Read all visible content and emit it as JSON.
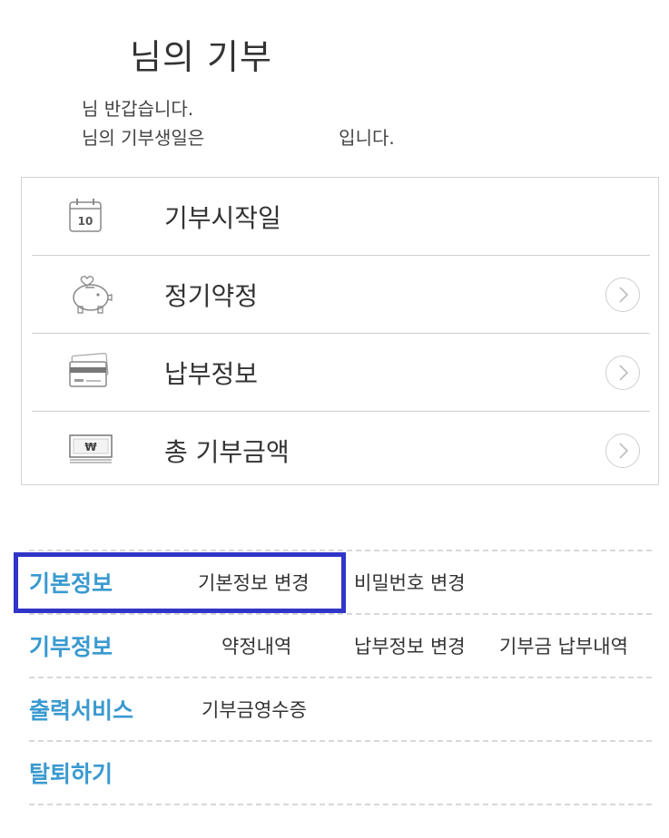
{
  "page": {
    "title": "님의 기부",
    "greeting_line1": "님 반갑습니다.",
    "greeting_line2_prefix": "님의 기부생일은",
    "greeting_line2_suffix": "입니다."
  },
  "summary": {
    "rows": [
      {
        "icon": "calendar-icon",
        "icon_text": "10",
        "label": "기부시작일",
        "has_arrow": false
      },
      {
        "icon": "piggy-bank-icon",
        "label": "정기약정",
        "has_arrow": true
      },
      {
        "icon": "credit-card-icon",
        "label": "납부정보",
        "has_arrow": true
      },
      {
        "icon": "won-bill-icon",
        "icon_text": "₩",
        "label": "총 기부금액",
        "has_arrow": true
      }
    ]
  },
  "menu": {
    "sections": [
      {
        "title": "기본정보",
        "links": [
          "기본정보 변경",
          "비밀번호 변경"
        ]
      },
      {
        "title": "기부정보",
        "links": [
          "약정내역",
          "납부정보 변경",
          "기부금 납부내역"
        ]
      },
      {
        "title": "출력서비스",
        "links": [
          "기부금영수증"
        ]
      },
      {
        "title": "탈퇴하기",
        "links": []
      }
    ]
  },
  "colors": {
    "accent": "#3a9ad0",
    "highlight_border": "#3035c8",
    "divider": "#cfcfcf"
  }
}
